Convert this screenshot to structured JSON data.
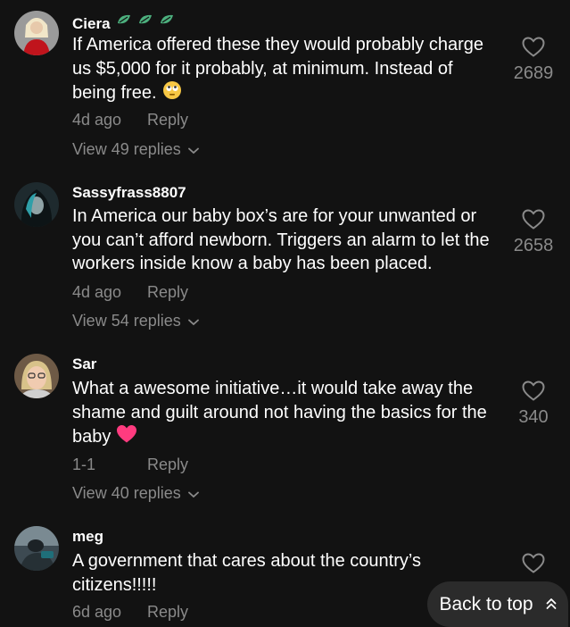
{
  "comments": [
    {
      "username": "Ciera",
      "text": "If America offered these they would probably charge us $5,000 for it probably, at minimum. Instead of being free.",
      "emoji": "eye-roll-face",
      "time": "4d ago",
      "reply_label": "Reply",
      "view_replies": "View 49 replies",
      "likes": "2689"
    },
    {
      "username": "Sassyfrass8807",
      "text": "In America our baby box’s are for your unwanted or you can’t afford newborn. Triggers an alarm to let the workers inside know a baby has been placed.",
      "time": "4d ago",
      "reply_label": "Reply",
      "view_replies": "View 54 replies",
      "likes": "2658"
    },
    {
      "username": "Sar",
      "text": "What a awesome initiative…it would take away the shame and guilt around not having the basics for the baby",
      "emoji": "pink-heart",
      "time": "1-1",
      "reply_label": "Reply",
      "view_replies": "View 40 replies",
      "likes": "340"
    },
    {
      "username": "meg",
      "text": "A government that cares about the country’s citizens!!!!!",
      "time": "6d ago",
      "reply_label": "Reply"
    }
  ],
  "back_to_top": "Back to top",
  "colors": {
    "background": "#121212",
    "muted_text": "#8a8a8a",
    "badge_green": "#4caf7d",
    "heart_pink": "#ff3b7f"
  }
}
